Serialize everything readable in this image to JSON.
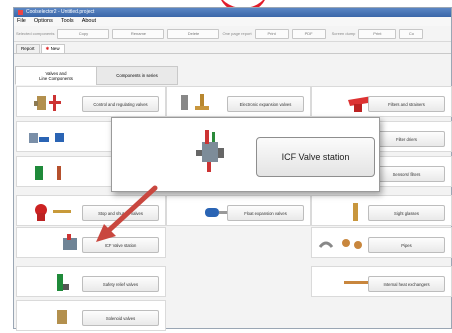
{
  "window": {
    "title": "Coolselector2 - Untitled.project"
  },
  "menu": [
    "File",
    "Options",
    "Tools",
    "About"
  ],
  "toolbar": {
    "selected_components_label": "Selected components",
    "buttons": [
      "Copy",
      "Rename",
      "Delete",
      "One page report",
      "Print",
      "PDF"
    ],
    "screen_dump_label": "Screen dump",
    "screen_buttons": [
      "Print",
      "Co"
    ]
  },
  "tabs": [
    "Report",
    "New"
  ],
  "subtabs": [
    "Valves and\nLine Components",
    "Components in series"
  ],
  "cells": {
    "control_regulating": "Control and regulating valves",
    "electronic_expansion": "Electronic expansion valves",
    "filters_strainers": "Filters and strainers",
    "filter_driers": "Filter driers",
    "sensors": "Sensors/ filters",
    "stop_shutoff": "Stop and shut-off valves",
    "float_expansion": "Float expansion valves",
    "sight_glasses": "Sight glasses",
    "icf_valve_station": "ICF Valve station",
    "pipes": "Pipes",
    "safety_relief": "Safety relief valves",
    "internal_heat_exchangers": "Internal heat exchangers",
    "solenoid": "Solenoid valves"
  },
  "popup": {
    "label": "ICF Valve station"
  },
  "colors": {
    "accent_red": "#e21c2a",
    "arrow": "#c9473f",
    "title_blue": "#3a66a8"
  }
}
